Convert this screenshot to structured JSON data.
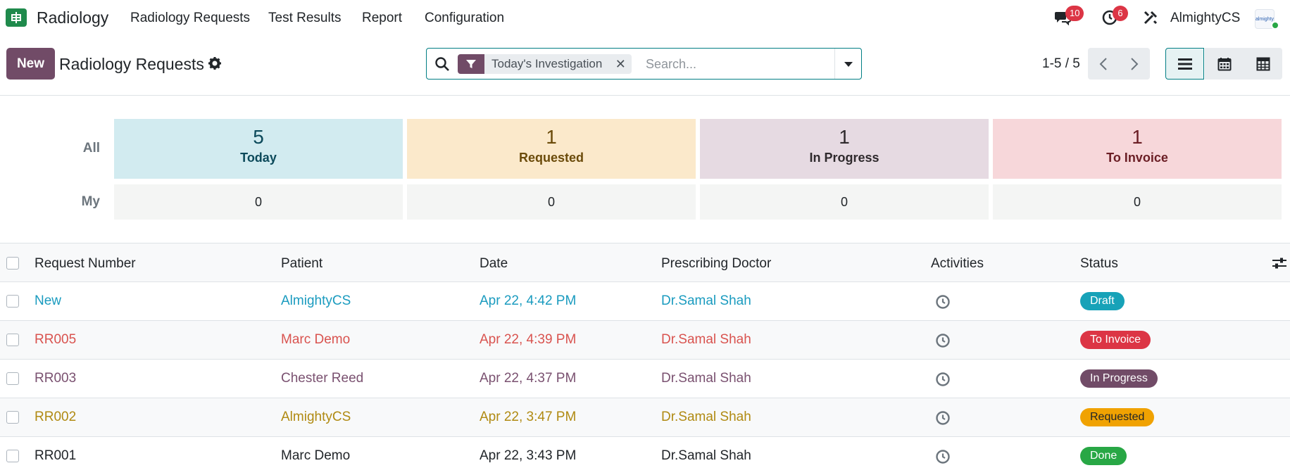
{
  "app": {
    "name": "Radiology",
    "icon": "hospital-app-icon"
  },
  "menu": [
    "Radiology Requests",
    "Test Results",
    "Report",
    "Configuration"
  ],
  "systray": {
    "messages_count": "10",
    "activities_count": "6",
    "user": "AlmightyCS",
    "avatar_text": "almighty"
  },
  "toolbar": {
    "new_label": "New",
    "title": "Radiology Requests"
  },
  "search": {
    "facet": "Today's Investigation",
    "placeholder": "Search..."
  },
  "pager": {
    "value": "1-5 / 5"
  },
  "dashboard": {
    "row_all": "All",
    "row_my": "My",
    "tiles": [
      {
        "count": "5",
        "label": "Today",
        "my": "0",
        "bg": "#d2ebf0",
        "fg": "#0c4a5b"
      },
      {
        "count": "1",
        "label": "Requested",
        "my": "0",
        "bg": "#fbe9cb",
        "fg": "#6b4b0a"
      },
      {
        "count": "1",
        "label": "In Progress",
        "my": "0",
        "bg": "#e6dae2",
        "fg": "#2f2a2d"
      },
      {
        "count": "1",
        "label": "To Invoice",
        "my": "0",
        "bg": "#f7d7da",
        "fg": "#6b1e25"
      }
    ]
  },
  "table": {
    "headers": [
      "Request Number",
      "Patient",
      "Date",
      "Prescribing Doctor",
      "Activities",
      "Status"
    ],
    "rows": [
      {
        "number": "New",
        "patient": "AlmightyCS",
        "date": "Apr 22, 4:42 PM",
        "doctor": "Dr.Samal Shah",
        "status": "Draft",
        "text_color": "#1a9bbf",
        "status_color": "#17a2b8"
      },
      {
        "number": "RR005",
        "patient": "Marc Demo",
        "date": "Apr 22, 4:39 PM",
        "doctor": "Dr.Samal Shah",
        "status": "To Invoice",
        "text_color": "#d9534f",
        "status_color": "#dc3545"
      },
      {
        "number": "RR003",
        "patient": "Chester Reed",
        "date": "Apr 22, 4:37 PM",
        "doctor": "Dr.Samal Shah",
        "status": "In Progress",
        "text_color": "#7a5170",
        "status_color": "#714b67"
      },
      {
        "number": "RR002",
        "patient": "AlmightyCS",
        "date": "Apr 22, 3:47 PM",
        "doctor": "Dr.Samal Shah",
        "status": "Requested",
        "text_color": "#b08a12",
        "status_color": "#f0a202"
      },
      {
        "number": "RR001",
        "patient": "Marc Demo",
        "date": "Apr 22, 3:43 PM",
        "doctor": "Dr.Samal Shah",
        "status": "Done",
        "text_color": "#212529",
        "status_color": "#28a745"
      }
    ]
  }
}
